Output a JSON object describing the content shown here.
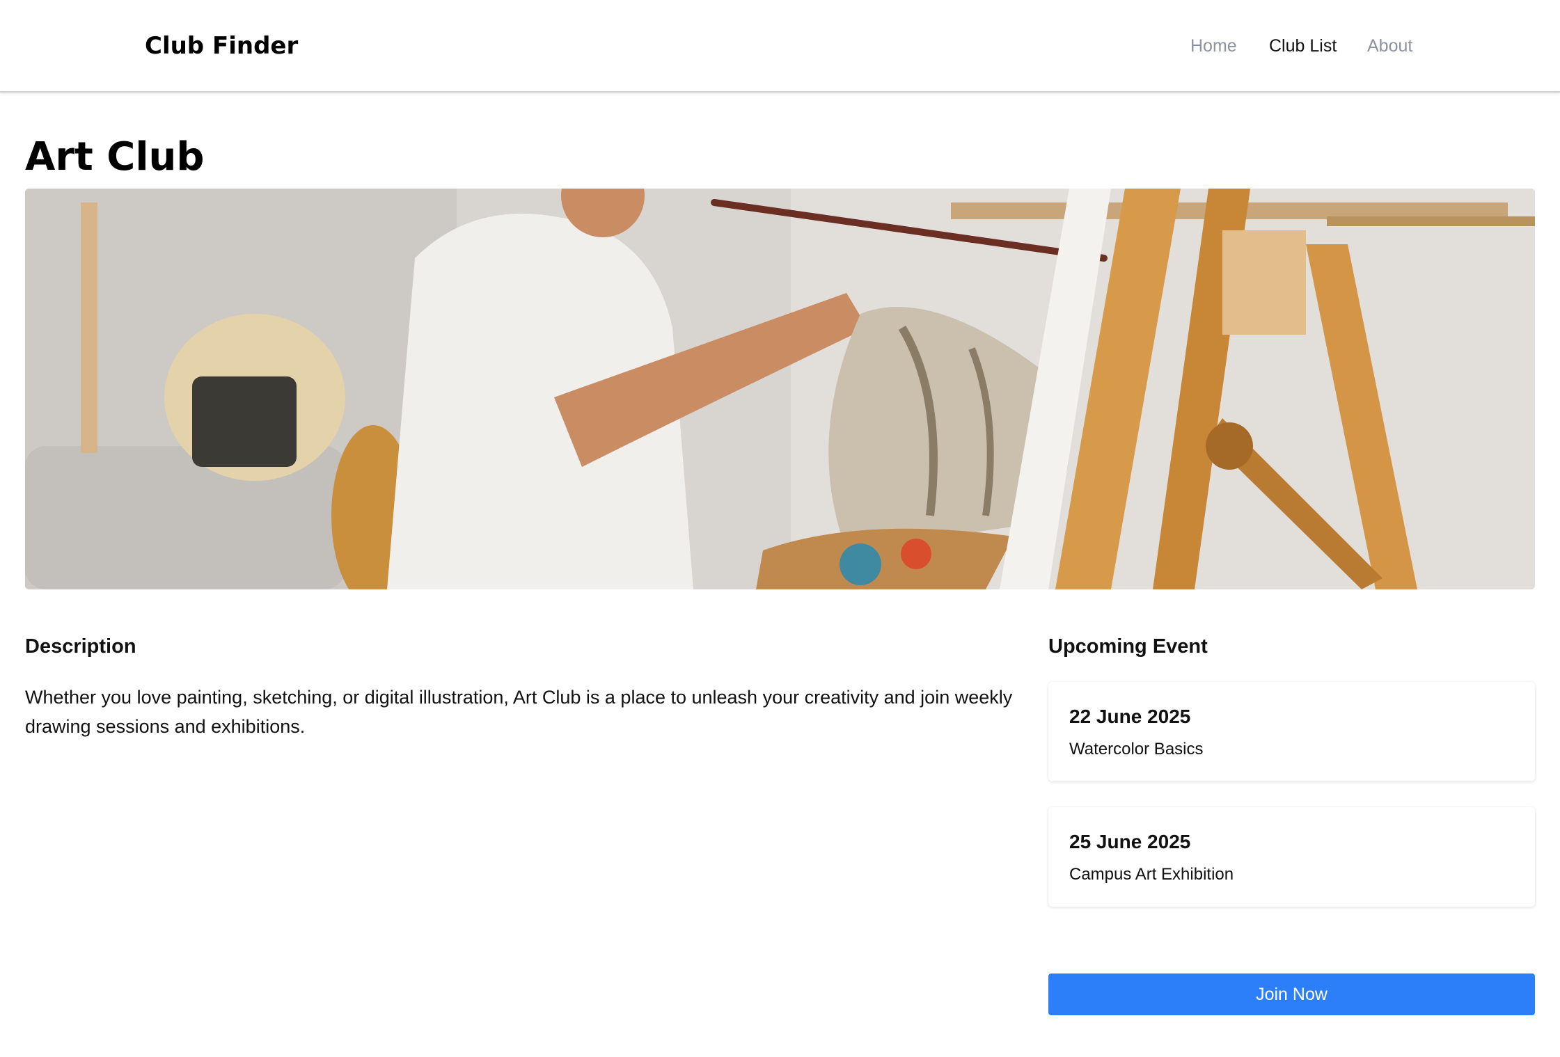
{
  "header": {
    "brand": "Club Finder",
    "nav": [
      {
        "label": "Home",
        "active": false
      },
      {
        "label": "Club List",
        "active": true
      },
      {
        "label": "About",
        "active": false
      }
    ]
  },
  "club": {
    "title": "Art Club",
    "hero_image": "person-painting-at-easel-photo"
  },
  "description": {
    "heading": "Description",
    "text": "Whether you love painting, sketching, or digital illustration, Art Club is a place to unleash your creativity and join weekly drawing sessions and exhibitions."
  },
  "events": {
    "heading": "Upcoming Event",
    "items": [
      {
        "date": "22 June 2025",
        "name": "Watercolor Basics"
      },
      {
        "date": "25 June 2025",
        "name": "Campus Art Exhibition"
      }
    ]
  },
  "actions": {
    "join_label": "Join Now"
  },
  "colors": {
    "accent": "#2d7ff9",
    "nav_inactive": "#8c93a0"
  }
}
